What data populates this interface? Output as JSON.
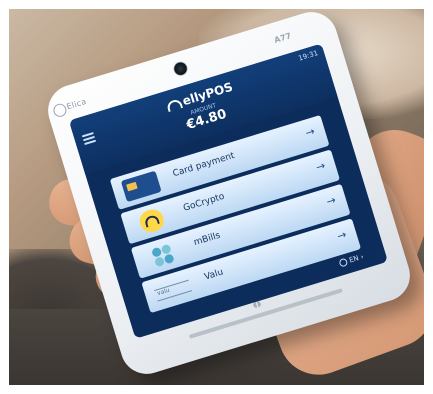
{
  "device": {
    "logo": "Elica",
    "model": "A77"
  },
  "screen": {
    "status": "19:31",
    "brand": "ellyPOS",
    "amount_label": "AMOUNT",
    "amount": "€4.80",
    "options": [
      {
        "label": "Card payment",
        "icon": "card-icon"
      },
      {
        "label": "GoCrypto",
        "icon": "gocrypto-icon"
      },
      {
        "label": "mBills",
        "icon": "mbills-icon"
      },
      {
        "label": "Valu",
        "icon": "valu-icon"
      }
    ],
    "language": "EN"
  },
  "colors": {
    "screen_bg": "#0c2c5c",
    "option_bg": "#d3e7fb",
    "gocrypto_yellow": "#ffd84a"
  }
}
